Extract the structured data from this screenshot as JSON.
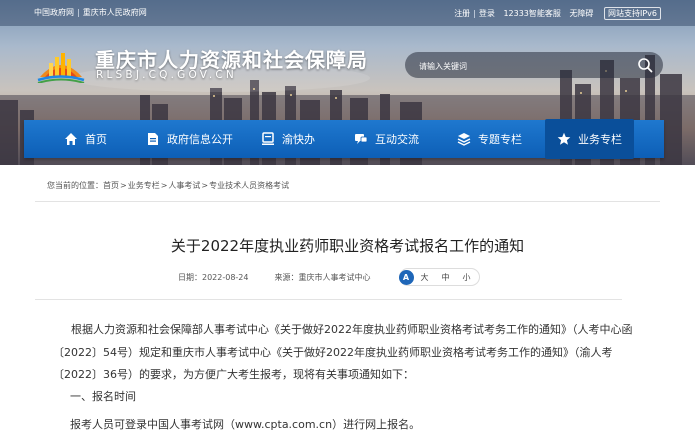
{
  "top_links": {
    "gov_cn": "中国政府网",
    "sep": "|",
    "mohrss": "重庆市人民政府网",
    "register": "注册",
    "login": "登录",
    "hotline": "12333智能客服",
    "accessibility": "无障碍",
    "ipv6": "网站支持IPv6"
  },
  "site": {
    "title": "重庆市人力资源和社会保障局",
    "domain": "RLSBJ.CQ.GOV.CN"
  },
  "search": {
    "placeholder": "请输入关键词",
    "icon": "search-icon"
  },
  "nav": {
    "items": [
      {
        "label": "首页",
        "icon": "home-icon"
      },
      {
        "label": "政府信息公开",
        "icon": "document-icon"
      },
      {
        "label": "渝快办",
        "icon": "service-icon"
      },
      {
        "label": "互动交流",
        "icon": "chat-icon"
      },
      {
        "label": "专题专栏",
        "icon": "layers-icon"
      },
      {
        "label": "业务专栏",
        "icon": "star-icon"
      }
    ],
    "active": "业务专栏"
  },
  "breadcrumb": {
    "prefix": "您当前的位置：",
    "items": [
      "首页",
      "业务专栏",
      "人事考试",
      "专业技术人员资格考试"
    ],
    "sep": ">"
  },
  "article": {
    "title": "关于2022年度执业药师职业资格考试报名工作的通知",
    "date_label": "日期：2022-08-24",
    "source_label": "来源：重庆市人事考试中心",
    "font_icon_char": "A",
    "font_sizes": [
      "大",
      "中",
      "小"
    ],
    "paragraphs": [
      "根据人力资源和社会保障部人事考试中心《关于做好2022年度执业药师职业资格考试考务工作的通知》（人考中心函〔2022〕54号）规定和重庆市人事考试中心《关于做好2022年度执业药师职业资格考试考务工作的通知》（渝人考〔2022〕36号）的要求，为方便广大考生报考，现将有关事项通知如下：",
      "一、报名时间",
      "报考人员可登录中国人事考试网（www.cpta.com.cn）进行网上报名。"
    ]
  },
  "colors": {
    "nav_blue": "#1565c0",
    "nav_active": "#0a4f9a",
    "font_icon_blue": "#1e66b8"
  }
}
